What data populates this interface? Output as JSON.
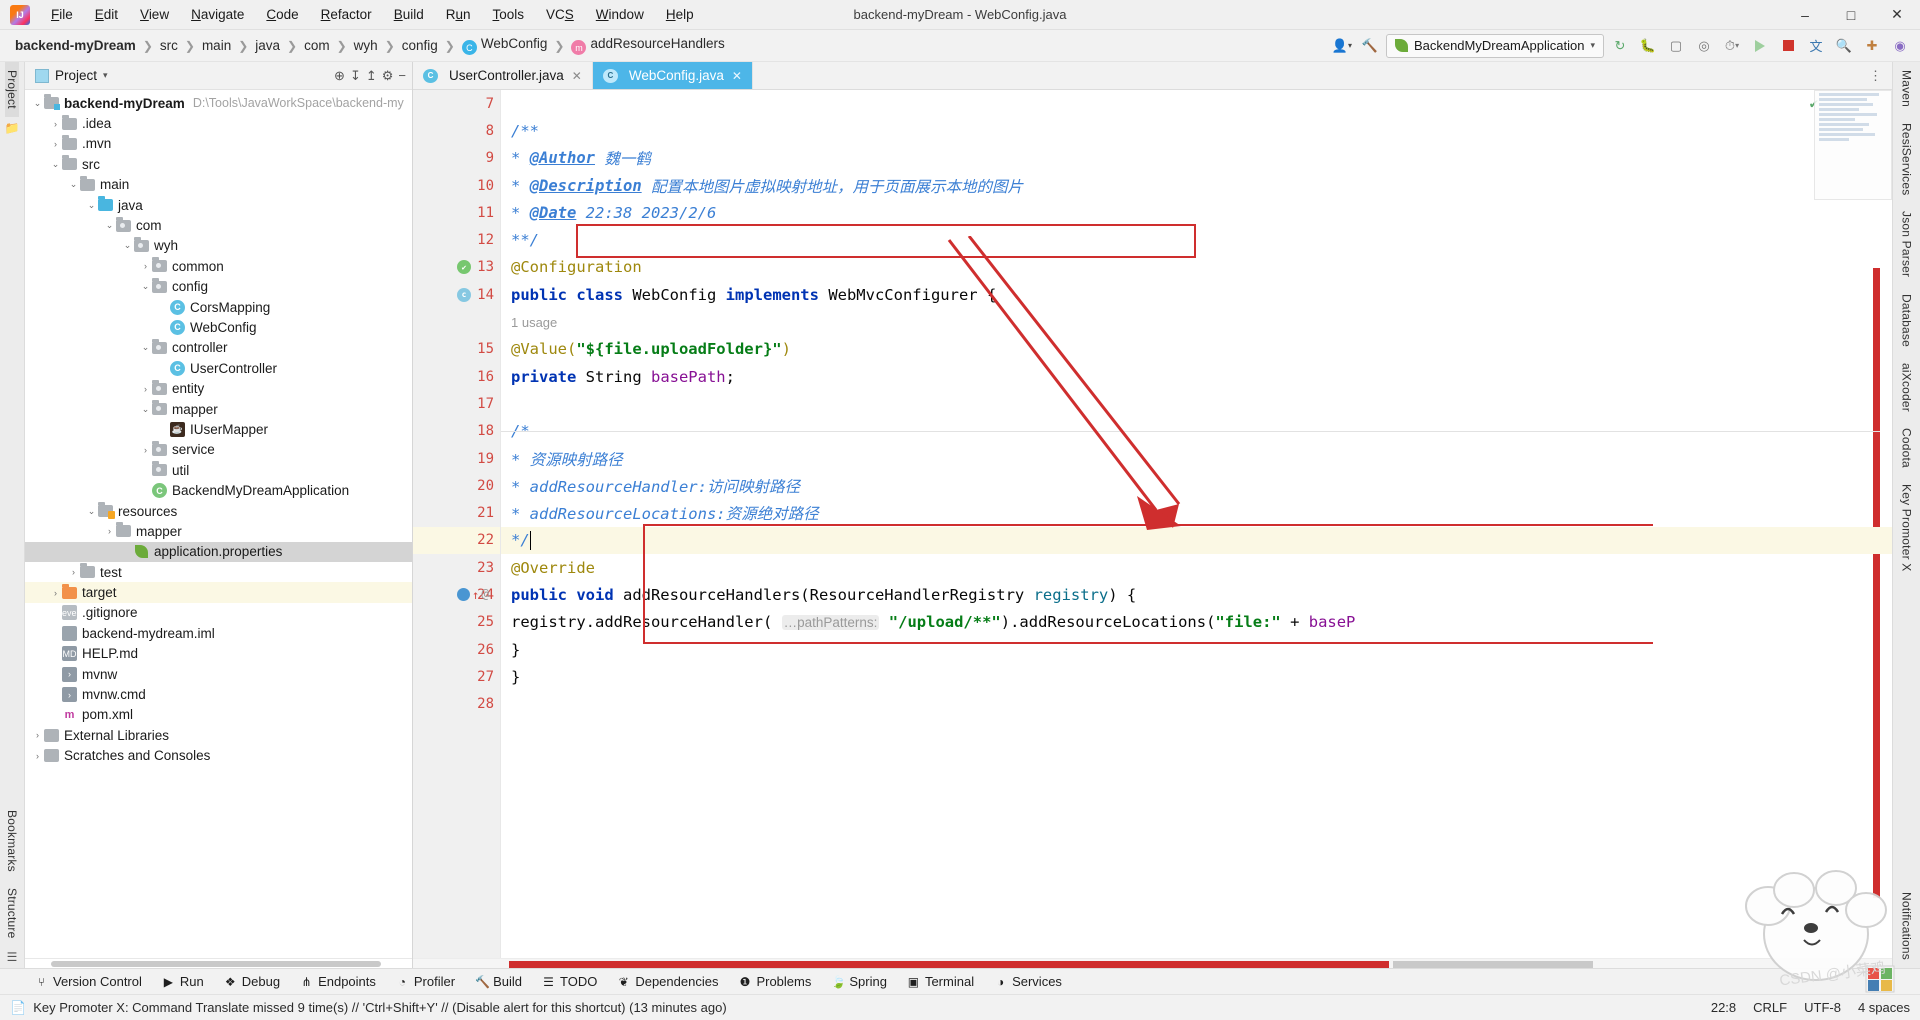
{
  "window": {
    "title": "backend-myDream - WebConfig.java",
    "logo_icon": "intellij-idea-logo",
    "minimize_icon": "–",
    "maximize_icon": "□",
    "close_icon": "✕"
  },
  "menu": [
    {
      "label": "File"
    },
    {
      "label": "Edit"
    },
    {
      "label": "View"
    },
    {
      "label": "Navigate"
    },
    {
      "label": "Code"
    },
    {
      "label": "Refactor"
    },
    {
      "label": "Build"
    },
    {
      "label": "Run"
    },
    {
      "label": "Tools"
    },
    {
      "label": "VCS"
    },
    {
      "label": "Window"
    },
    {
      "label": "Help"
    }
  ],
  "breadcrumbs": [
    {
      "label": "backend-myDream",
      "icon": "",
      "bold": true
    },
    {
      "label": "src",
      "icon": ""
    },
    {
      "label": "main",
      "icon": ""
    },
    {
      "label": "java",
      "icon": ""
    },
    {
      "label": "com",
      "icon": ""
    },
    {
      "label": "wyh",
      "icon": ""
    },
    {
      "label": "config",
      "icon": ""
    },
    {
      "label": "WebConfig",
      "icon": "class-icon"
    },
    {
      "label": "addResourceHandlers",
      "icon": "method-icon"
    }
  ],
  "toolbar": {
    "user_icon": "user-account-icon",
    "hammer_icon": "build-hammer-icon",
    "run_config": "BackendMyDreamApplication",
    "run_config_icon": "spring-leaf-icon",
    "chevron": "▾",
    "rerun_icon": "↻",
    "debug_icon": "debug-bug-icon",
    "coverage_icon": "coverage-icon",
    "profiler_icon": "profiler-icon",
    "clock_icon": "recent-icon",
    "run_icon": "run-triangle-icon",
    "stop_icon": "stop-square-icon",
    "translate_icon": "translate-icon",
    "search_icon": "search-icon",
    "plugin_icon": "plugin-update-icon",
    "avatar_icon": "avatar-icon"
  },
  "left_rail": {
    "project_label": "Project",
    "structure_label": "Structure",
    "bookmarks_label": "Bookmarks",
    "folder_icon": "folder-icon"
  },
  "right_rail": [
    {
      "label": "Maven"
    },
    {
      "label": "ResiServices"
    },
    {
      "label": "Json Parser"
    },
    {
      "label": "Database"
    },
    {
      "label": "aiXcoder"
    },
    {
      "label": "Codota"
    },
    {
      "label": "Key Promoter X"
    },
    {
      "label": "Notifications"
    }
  ],
  "project_panel": {
    "title": "Project",
    "chevron": "▾",
    "icons": [
      "locate-icon",
      "expand-all-icon",
      "collapse-all-icon",
      "settings-gear-icon",
      "hide-icon"
    ],
    "tree": [
      {
        "label": "backend-myDream",
        "path": "D:\\Tools\\JavaWorkSpace\\backend-my",
        "depth": 0,
        "arrow": "v",
        "icon": "module-folder",
        "bold": true
      },
      {
        "label": ".idea",
        "depth": 1,
        "arrow": ">",
        "icon": "folder"
      },
      {
        "label": ".mvn",
        "depth": 1,
        "arrow": ">",
        "icon": "folder"
      },
      {
        "label": "src",
        "depth": 1,
        "arrow": "v",
        "icon": "folder"
      },
      {
        "label": "main",
        "depth": 2,
        "arrow": "v",
        "icon": "folder"
      },
      {
        "label": "java",
        "depth": 3,
        "arrow": "v",
        "icon": "source-folder"
      },
      {
        "label": "com",
        "depth": 4,
        "arrow": "v",
        "icon": "package"
      },
      {
        "label": "wyh",
        "depth": 5,
        "arrow": "v",
        "icon": "package"
      },
      {
        "label": "common",
        "depth": 6,
        "arrow": ">",
        "icon": "package"
      },
      {
        "label": "config",
        "depth": 6,
        "arrow": "v",
        "icon": "package"
      },
      {
        "label": "CorsMapping",
        "depth": 7,
        "arrow": "",
        "icon": "class"
      },
      {
        "label": "WebConfig",
        "depth": 7,
        "arrow": "",
        "icon": "class"
      },
      {
        "label": "controller",
        "depth": 6,
        "arrow": "v",
        "icon": "package"
      },
      {
        "label": "UserController",
        "depth": 7,
        "arrow": "",
        "icon": "class"
      },
      {
        "label": "entity",
        "depth": 6,
        "arrow": ">",
        "icon": "package"
      },
      {
        "label": "mapper",
        "depth": 6,
        "arrow": "v",
        "icon": "package"
      },
      {
        "label": "IUserMapper",
        "depth": 7,
        "arrow": "",
        "icon": "mybatis"
      },
      {
        "label": "service",
        "depth": 6,
        "arrow": ">",
        "icon": "package"
      },
      {
        "label": "util",
        "depth": 6,
        "arrow": "",
        "icon": "package"
      },
      {
        "label": "BackendMyDreamApplication",
        "depth": 6,
        "arrow": "",
        "icon": "spring-class"
      },
      {
        "label": "resources",
        "depth": 3,
        "arrow": "v",
        "icon": "resource-folder"
      },
      {
        "label": "mapper",
        "depth": 4,
        "arrow": ">",
        "icon": "folder"
      },
      {
        "label": "application.properties",
        "depth": 5,
        "arrow": "",
        "icon": "spring-properties",
        "selected": true
      },
      {
        "label": "test",
        "depth": 2,
        "arrow": ">",
        "icon": "folder"
      },
      {
        "label": "target",
        "depth": 1,
        "arrow": ">",
        "icon": "target-folder",
        "highlight": true
      },
      {
        "label": ".gitignore",
        "depth": 1,
        "arrow": "",
        "icon": "gitignore"
      },
      {
        "label": "backend-mydream.iml",
        "depth": 1,
        "arrow": "",
        "icon": "iml"
      },
      {
        "label": "HELP.md",
        "depth": 1,
        "arrow": "",
        "icon": "markdown"
      },
      {
        "label": "mvnw",
        "depth": 1,
        "arrow": "",
        "icon": "shell"
      },
      {
        "label": "mvnw.cmd",
        "depth": 1,
        "arrow": "",
        "icon": "shell"
      },
      {
        "label": "pom.xml",
        "depth": 1,
        "arrow": "",
        "icon": "maven-xml"
      },
      {
        "label": "External Libraries",
        "depth": 0,
        "arrow": ">",
        "icon": "libraries"
      },
      {
        "label": "Scratches and Consoles",
        "depth": 0,
        "arrow": ">",
        "icon": "scratches"
      }
    ]
  },
  "editor": {
    "tabs": [
      {
        "label": "UserController.java",
        "icon": "class-icon",
        "close": "✕",
        "active": false
      },
      {
        "label": "WebConfig.java",
        "icon": "class-icon",
        "close": "✕",
        "active": true
      }
    ],
    "more_icon": "⋮",
    "code_lines": [
      {
        "n": "7",
        "html": ""
      },
      {
        "n": "8",
        "html": "<span class='doc'>/**</span>",
        "fold": true
      },
      {
        "n": "9",
        "html": "  <span class='doc'>* </span><span class='doctag'>@Author</span><span class='doc'> 魏一鹤</span>"
      },
      {
        "n": "10",
        "html": "  <span class='doc'>* </span><span class='doctag'>@Description</span><span class='doc'> 配置本地图片虚拟映射地址，用于页面展示本地的图片</span>"
      },
      {
        "n": "11",
        "html": "  <span class='doc'>* </span><span class='doctag'>@Date</span><span class='doc'> 22:38 2023/2/6</span>"
      },
      {
        "n": "12",
        "html": "  <span class='doc'>**/</span>",
        "fold": true
      },
      {
        "n": "13",
        "html": "<span class='anno'>@Configuration</span>",
        "bean": "green"
      },
      {
        "n": "14",
        "html": "<span class='kw'>public class </span><span class='plain'>WebConfig </span><span class='kw'>implements </span><span class='plain'>WebMvcConfigurer {</span>",
        "bean": "blue"
      },
      {
        "n": "",
        "html": "    <span class='usage'>1 usage</span>",
        "nonum": true
      },
      {
        "n": "15",
        "html": "    <span class='anno'>@Value(</span><span class='str'>\"${file.uploadFolder}\"</span><span class='anno'>)</span>"
      },
      {
        "n": "16",
        "html": "    <span class='kw'>private </span><span class='plain'>String </span><span class='fld'>basePath</span><span class='plain'>;</span>"
      },
      {
        "n": "17",
        "html": ""
      },
      {
        "n": "18",
        "html": "    <span class='doc'>/*</span>",
        "fold": true,
        "sep": true
      },
      {
        "n": "19",
        "html": "     <span class='doc'>* 资源映射路径</span>"
      },
      {
        "n": "20",
        "html": "     <span class='doc'>* addResourceHandler:访问映射路径</span>"
      },
      {
        "n": "21",
        "html": "     <span class='doc'>* addResourceLocations:资源绝对路径</span>"
      },
      {
        "n": "22",
        "html": "     <span class='doc'>*/</span><span class='caret'></span>",
        "fold": true,
        "hl": true
      },
      {
        "n": "23",
        "html": "    <span class='anno'>@Override</span>"
      },
      {
        "n": "24",
        "html": "    <span class='kw'>public void </span><span class='plain'>addResourceHandlers(</span><span class='plain'>ResourceHandlerRegistry </span><span class='prm'>registry</span><span class='plain'>) {</span>",
        "gutter_override": true,
        "fold": true
      },
      {
        "n": "25",
        "html": "        <span class='plain'>registry.addResourceHandler( </span><span class='hint'>…pathPatterns:</span><span class='plain'> </span><span class='str'>\"/upload/**\"</span><span class='plain'>).addResourceLocations(</span><span class='str'>\"file:\"</span><span class='plain'> + </span><span class='fld'>baseP</span>"
      },
      {
        "n": "26",
        "html": "    <span class='plain'>}</span>",
        "fold": true
      },
      {
        "n": "27",
        "html": "<span class='plain'>}</span>"
      },
      {
        "n": "28",
        "html": ""
      }
    ]
  },
  "bottom_tools": [
    {
      "label": "Version Control",
      "icon": "branch-icon"
    },
    {
      "label": "Run",
      "icon": "run-icon"
    },
    {
      "label": "Debug",
      "icon": "debug-icon"
    },
    {
      "label": "Endpoints",
      "icon": "endpoints-icon"
    },
    {
      "label": "Profiler",
      "icon": "profiler-icon"
    },
    {
      "label": "Build",
      "icon": "build-hammer-icon"
    },
    {
      "label": "TODO",
      "icon": "todo-list-icon"
    },
    {
      "label": "Dependencies",
      "icon": "dependencies-icon"
    },
    {
      "label": "Problems",
      "icon": "problems-icon"
    },
    {
      "label": "Spring",
      "icon": "spring-leaf-icon"
    },
    {
      "label": "Terminal",
      "icon": "terminal-icon"
    },
    {
      "label": "Services",
      "icon": "services-icon"
    }
  ],
  "statusbar": {
    "icon": "notification-icon",
    "message": "Key Promoter X: Command Translate missed 9 time(s) // 'Ctrl+Shift+Y' // (Disable alert for this shortcut) (13 minutes ago)",
    "caret_position": "22:8",
    "line_separator": "CRLF",
    "encoding": "UTF-8",
    "indent": "4 spaces"
  },
  "watermark_text": "CSDN @小菜鸡",
  "colors": {
    "annotation_red": "#cf2e2e",
    "tab_active": "#4db6e8",
    "highlight_line": "#fbf8e4",
    "selection_gray": "#d4d4d4"
  }
}
